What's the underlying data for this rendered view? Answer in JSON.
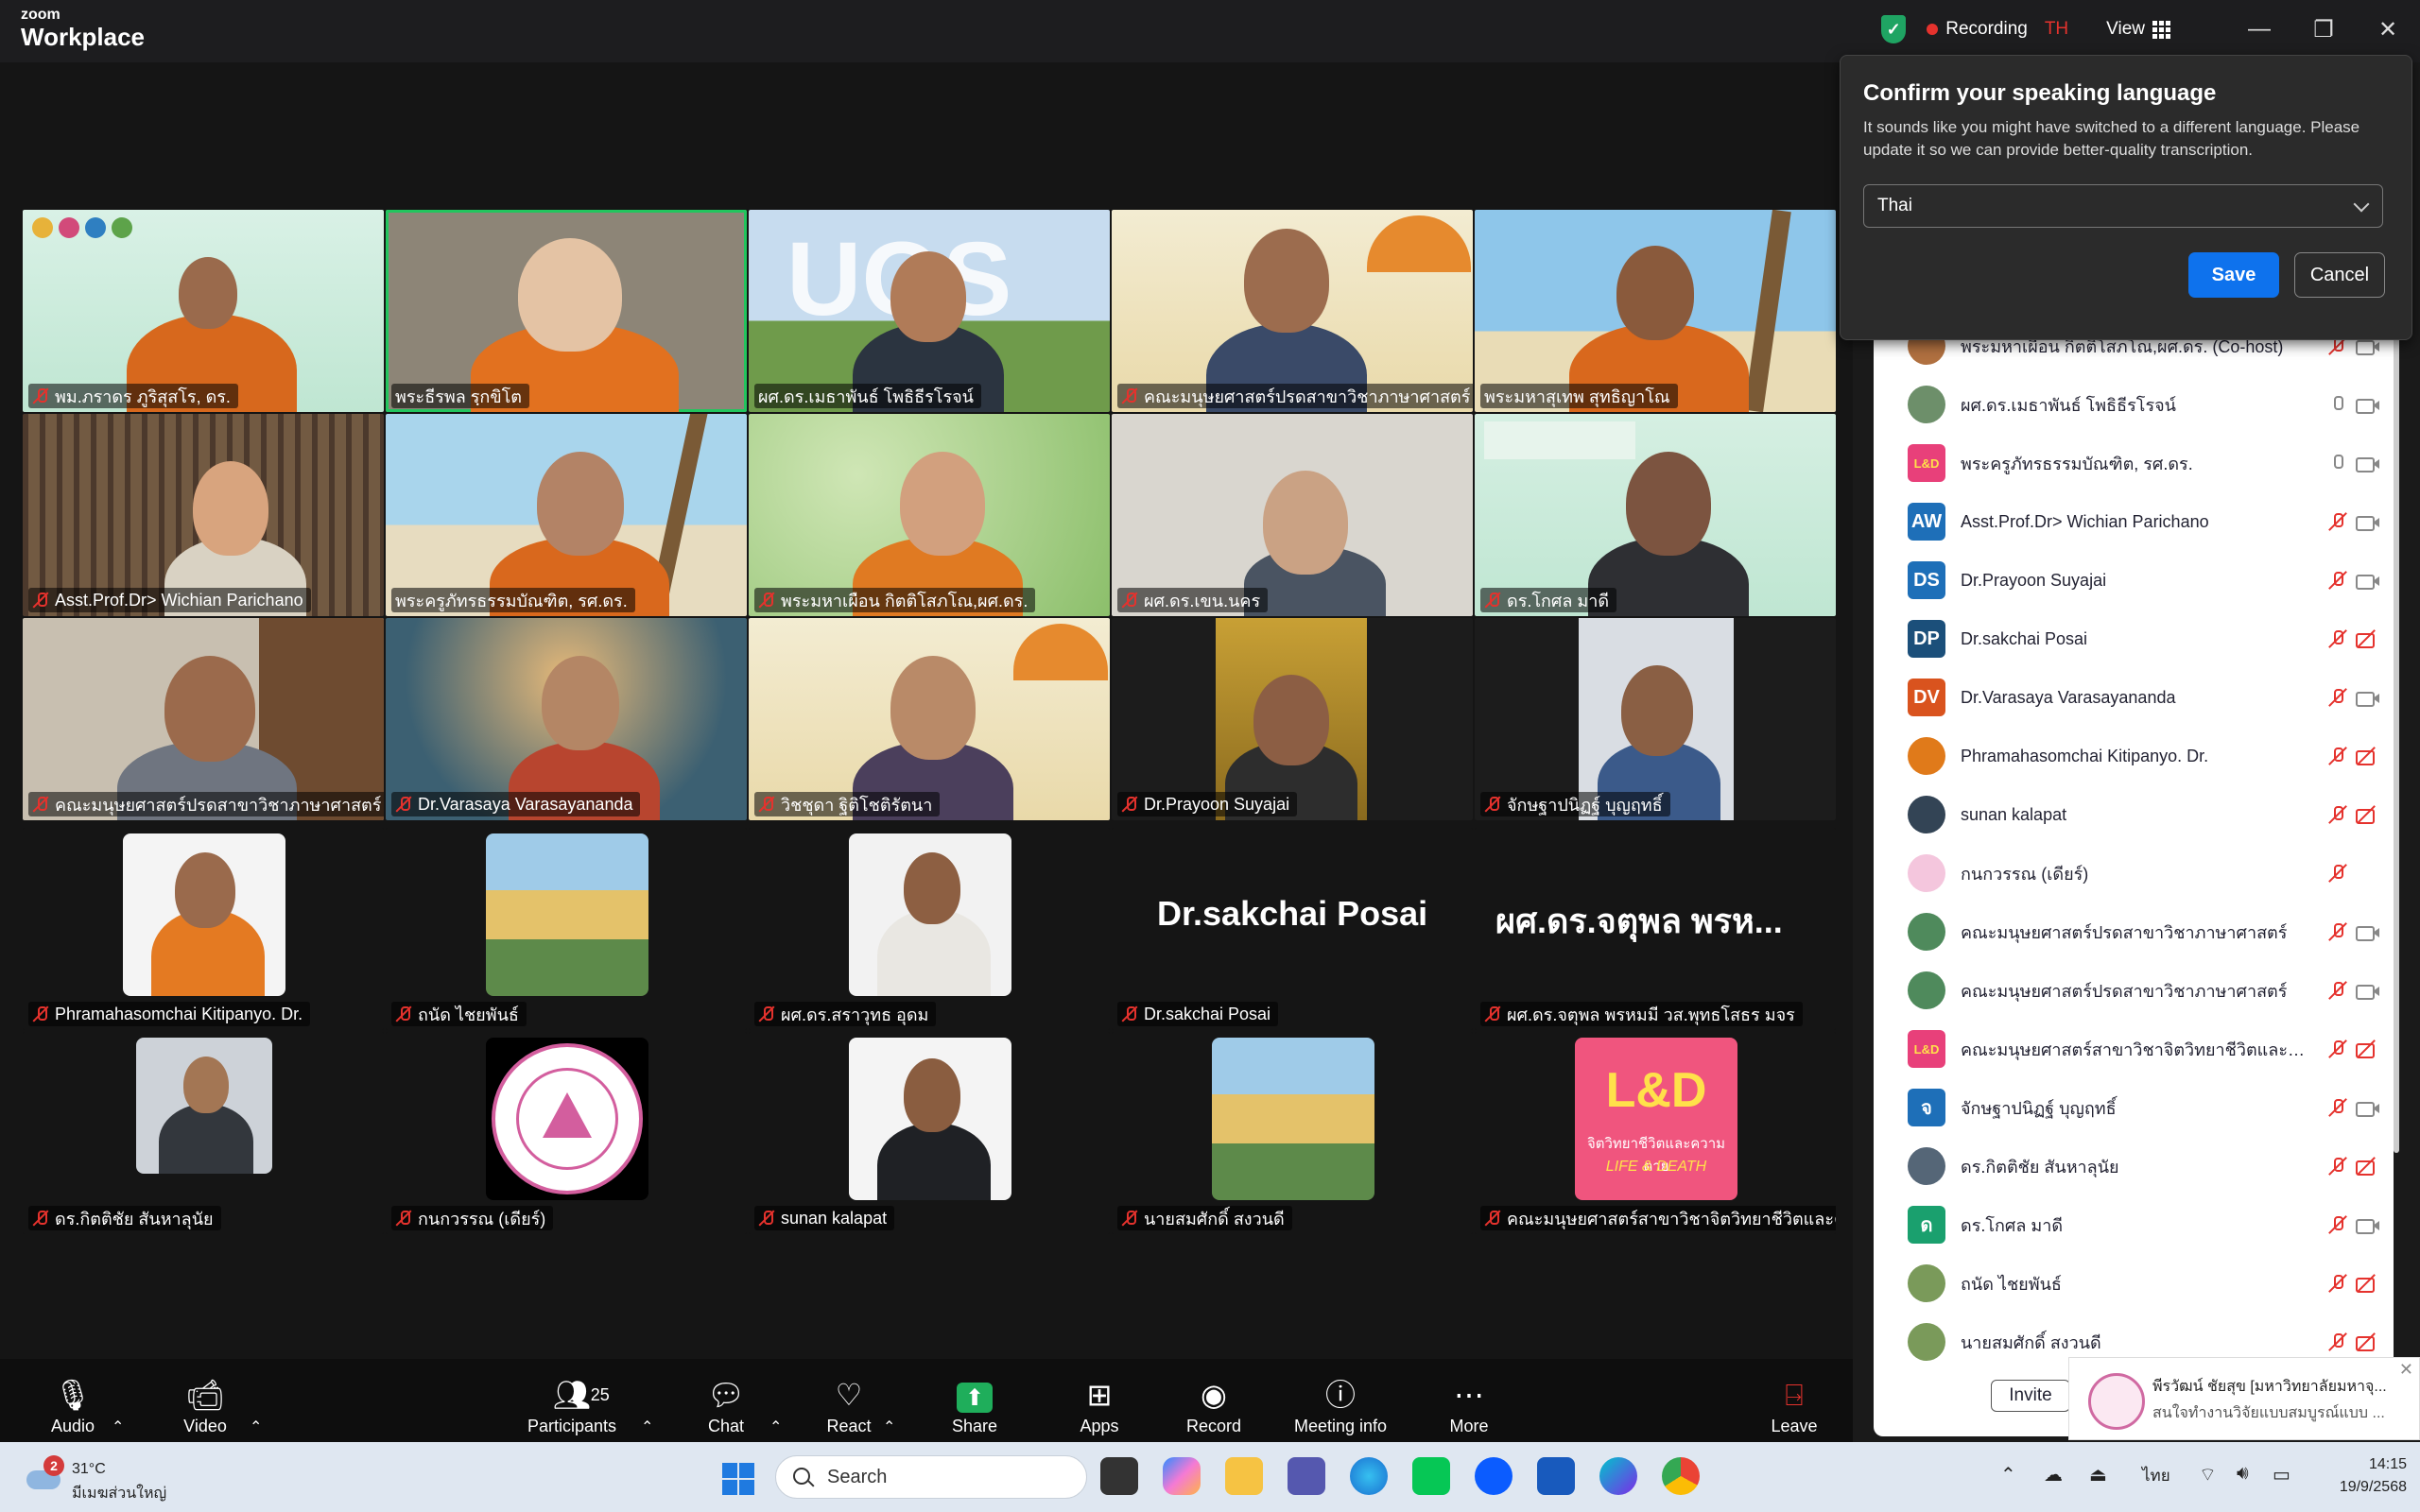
{
  "app": {
    "brand_small": "zoom",
    "brand_large": "Workplace"
  },
  "topbar": {
    "recording": "Recording",
    "lang_code": "TH",
    "view": "View",
    "minimize": "—",
    "maximize": "❐",
    "close": "✕"
  },
  "dialog": {
    "title": "Confirm your speaking language",
    "body": "It sounds like you might have switched to a different language. Please update it so we can provide better-quality transcription.",
    "selected": "Thai",
    "save": "Save",
    "cancel": "Cancel"
  },
  "tiles": [
    "พม.ภราดร ภูริสุสโร, ดร.",
    "พระธีรพล รฺกขิโต",
    "ผศ.ดร.เมธาพันธ์ โพธิธีรโรจน์",
    "คณะมนุษยศาสตร์ปรดสาขาวิชาภาษาศาสตร์",
    "พระมหาสุเทพ สุทธิญาโณ",
    "Asst.Prof.Dr> Wichian Parichano",
    "พระครูภัทรธรรมบัณฑิต, รศ.ดร.",
    "พระมหาเผือน กิตติโสภโณ,ผศ.ดร.",
    "ผศ.ดร.เขน.นคร",
    "ดร.โกศล มาดี",
    "คณะมนุษยศาสตร์ปรดสาขาวิชาภาษาศาสตร์",
    "Dr.Varasaya Varasayananda",
    "วิชชุดา ฐิติโชติรัตนา",
    "Dr.Prayoon Suyajai",
    "จักษฐาปนิฏฐ์ บุญฤทธิ์"
  ],
  "avatar_tiles": [
    "Phramahasomchai Kitipanyo. Dr.",
    "ถนัด ไชยพันธ์",
    "ผศ.ดร.สราวุทธ อุดม",
    "Dr.sakchai Posai",
    "ผศ.ดร.จตุพล  พรหมมี วส.พุทธโสธร มจร",
    "ดร.กิตติชัย สันหาลุนัย",
    "กนกวรรณ (เดียร์)",
    "sunan kalapat",
    "นายสมศักดิ์ สงวนดี",
    "คณะมนุษยศาสตร์สาขาวิชาจิตวิทยาชีวิตและคว..."
  ],
  "big_names": {
    "sakchai": "Dr.sakchai Posai",
    "jatupon": "ผศ.ดร.จตุพล  พรห..."
  },
  "ld_logo": {
    "text": "L&D",
    "sub1": "จิตวิทยาชีวิตและความตาย",
    "sub2": "LIFE & DEATH"
  },
  "participants": [
    {
      "name": "พระมหาเผือน กิตติโสภโณ,ผศ.ดร. (Co-host)",
      "initials": "",
      "color": "#b07040",
      "mic": "off",
      "cam": "on"
    },
    {
      "name": "ผศ.ดร.เมธาพันธ์ โพธิธีรโรจน์",
      "initials": "",
      "color": "#6d8f6a",
      "mic": "on",
      "cam": "on"
    },
    {
      "name": "พระครูภัทรธรรมบัณฑิต, รศ.ดร.",
      "initials": "L&D",
      "color": "#e8407a",
      "mic": "on",
      "cam": "on"
    },
    {
      "name": "Asst.Prof.Dr> Wichian Parichano",
      "initials": "AW",
      "color": "#1e6fb8",
      "mic": "off",
      "cam": "on"
    },
    {
      "name": "Dr.Prayoon Suyajai",
      "initials": "DS",
      "color": "#1e6fb8",
      "mic": "off",
      "cam": "on"
    },
    {
      "name": "Dr.sakchai Posai",
      "initials": "DP",
      "color": "#1b4f7a",
      "mic": "off",
      "cam": "off"
    },
    {
      "name": "Dr.Varasaya Varasayananda",
      "initials": "DV",
      "color": "#d9531e",
      "mic": "off",
      "cam": "on"
    },
    {
      "name": "Phramahasomchai Kitipanyo. Dr.",
      "initials": "",
      "color": "#e07a1a",
      "mic": "off",
      "cam": "off"
    },
    {
      "name": "sunan kalapat",
      "initials": "",
      "color": "#334455",
      "mic": "off",
      "cam": "off"
    },
    {
      "name": "กนกวรรณ (เดียร์)",
      "initials": "",
      "color": "#f4c6dd",
      "mic": "off",
      "cam": ""
    },
    {
      "name": "คณะมนุษยศาสตร์ปรดสาขาวิชาภาษาศาสตร์",
      "initials": "",
      "color": "#4f8a5c",
      "mic": "off",
      "cam": "on"
    },
    {
      "name": "คณะมนุษยศาสตร์ปรดสาขาวิชาภาษาศาสตร์",
      "initials": "",
      "color": "#4f8a5c",
      "mic": "off",
      "cam": "on"
    },
    {
      "name": "คณะมนุษยศาสตร์สาขาวิชาจิตวิทยาชีวิตและควา...",
      "initials": "L&D",
      "color": "#e8407a",
      "mic": "off",
      "cam": "off"
    },
    {
      "name": "จักษฐาปนิฏฐ์ บุญฤทธิ์",
      "initials": "จ",
      "color": "#1e6fb8",
      "mic": "off",
      "cam": "on"
    },
    {
      "name": "ดร.กิตติชัย สันหาลุนัย",
      "initials": "",
      "color": "#556677",
      "mic": "off",
      "cam": "off"
    },
    {
      "name": "ดร.โกศล มาดี",
      "initials": "ด",
      "color": "#1aa06e",
      "mic": "off",
      "cam": "on"
    },
    {
      "name": "ถนัด ไชยพันธ์",
      "initials": "",
      "color": "#7a9a5a",
      "mic": "off",
      "cam": "off"
    },
    {
      "name": "นายสมศักดิ์ สงวนดี",
      "initials": "",
      "color": "#7a9a5a",
      "mic": "off",
      "cam": "off"
    }
  ],
  "invite": "Invite",
  "notification": {
    "title": "พีรวัฒน์ ชัยสุข [มหาวิทยาลัยมหาจุ...",
    "body": "สนใจทำงานวิจัยแบบสมบูรณ์แบบ ..."
  },
  "toolbar": {
    "audio": "Audio",
    "video": "Video",
    "participants": "Participants",
    "participants_count": "25",
    "chat": "Chat",
    "react": "React",
    "share": "Share",
    "apps": "Apps",
    "record": "Record",
    "meeting_info": "Meeting info",
    "more": "More",
    "leave": "Leave"
  },
  "taskbar": {
    "weather_badge": "2",
    "temp": "31°C",
    "weather_desc": "มีเมฆส่วนใหญ่",
    "search": "Search",
    "lang": "ไทย",
    "time": "14:15",
    "date": "19/9/2568"
  },
  "colors": {
    "accent": "#0e72ed",
    "muted_red": "#e5322d",
    "active_speaker": "#22c55e"
  }
}
